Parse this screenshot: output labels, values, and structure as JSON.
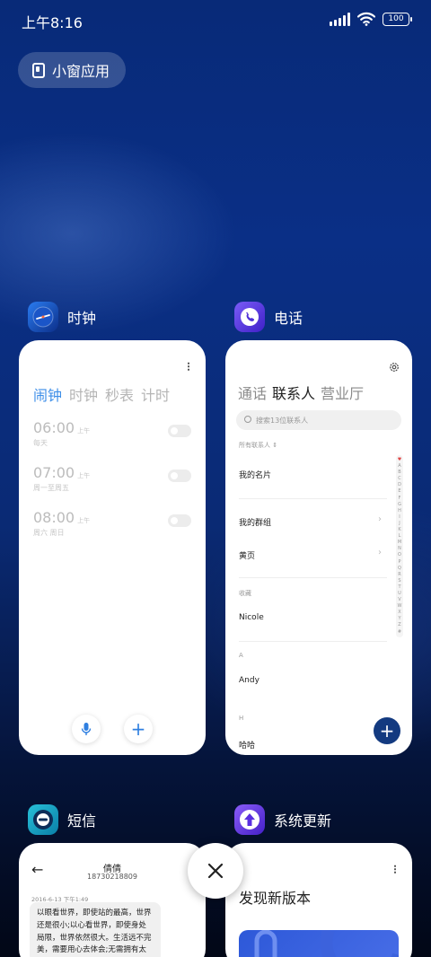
{
  "status_bar": {
    "time": "上午8:16",
    "battery": "100"
  },
  "small_window": {
    "label": "小窗应用"
  },
  "apps": {
    "clock": {
      "title": "时钟",
      "tabs": [
        "闹钟",
        "时钟",
        "秒表",
        "计时"
      ],
      "alarms": [
        {
          "time": "06:00",
          "ampm": "上午",
          "repeat": "每天"
        },
        {
          "time": "07:00",
          "ampm": "上午",
          "repeat": "周一至周五"
        },
        {
          "time": "08:00",
          "ampm": "上午",
          "repeat": "周六 周日"
        }
      ]
    },
    "phone": {
      "title": "电话",
      "tabs": [
        "通话",
        "联系人",
        "营业厅"
      ],
      "search_placeholder": "搜索13位联系人",
      "all_contacts": "所有联系人",
      "my_card": "我的名片",
      "my_groups": "我的群组",
      "yellow_pages": "黄页",
      "favorites_label": "收藏",
      "favorites": [
        "Nicole"
      ],
      "section_a": "A",
      "contact_a": "Andy",
      "section_h": "H",
      "contact_h": "哈哈",
      "index_letters": [
        "♥",
        "A",
        "B",
        "C",
        "D",
        "E",
        "F",
        "G",
        "H",
        "I",
        "J",
        "K",
        "L",
        "M",
        "N",
        "O",
        "P",
        "Q",
        "R",
        "S",
        "T",
        "U",
        "V",
        "W",
        "X",
        "Y",
        "Z",
        "#"
      ]
    },
    "sms": {
      "title": "短信",
      "contact_name": "倩倩",
      "contact_number": "18730218809",
      "timestamp": "2016-6-13 下午1:49",
      "message": "以眼看世界，即使站的最高，世界还是很小;以心看世界，即使身处局限，世界依然很大。生活远不完美，需要用心去体会;无需拥有太"
    },
    "update": {
      "title": "系统更新",
      "heading": "发现新版本"
    }
  },
  "colors": {
    "clock_accent": "#3d8ee8",
    "phone_fab": "#133a80"
  }
}
